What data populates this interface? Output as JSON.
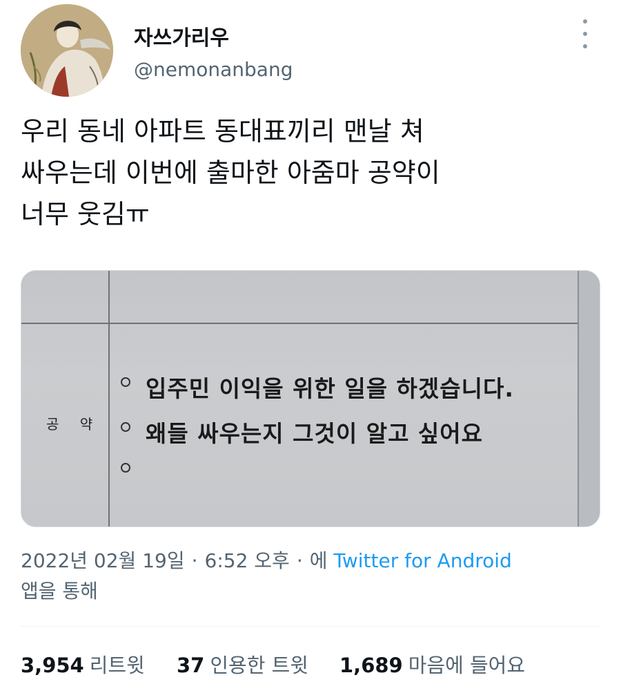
{
  "author": {
    "display_name": "자쓰가리우",
    "handle": "@nemonanbang"
  },
  "tweet": {
    "lines": [
      "우리 동네 아파트 동대표끼리 맨날 쳐",
      "싸우는데 이번에 출마한 아줌마 공약이",
      "너무 웃김ㅠ"
    ]
  },
  "media": {
    "field_label": "공 약",
    "pledges": [
      "입주민 이익을 위한 일을 하겠습니다.",
      "왜들 싸우는지 그것이 알고 싶어요",
      ""
    ]
  },
  "meta": {
    "date": "2022년 02월 19일",
    "time": "6:52 오후",
    "via_prefix": "에",
    "source": "Twitter for Android",
    "via_suffix": "앱을 통해"
  },
  "stats": {
    "retweets": {
      "count": "3,954",
      "label": "리트윗"
    },
    "quotes": {
      "count": "37",
      "label": "인용한 트윗"
    },
    "likes": {
      "count": "1,689",
      "label": "마음에 들어요"
    }
  },
  "colors": {
    "link": "#1d9bf0",
    "secondary_text": "#536471",
    "primary_text": "#0f1419"
  },
  "icons": {
    "more": "more-vertical-icon"
  }
}
